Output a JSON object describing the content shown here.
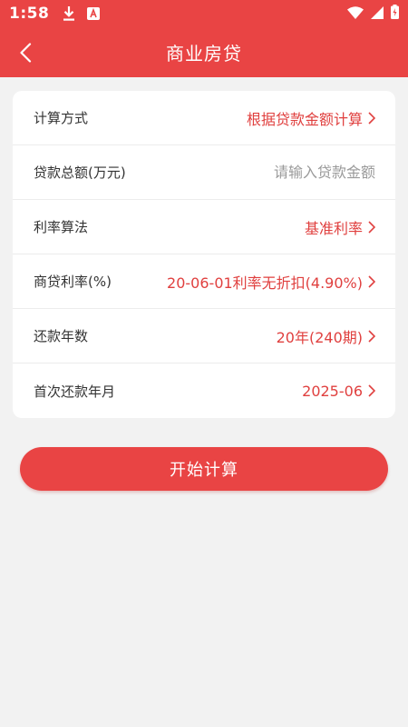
{
  "status_bar": {
    "time": "1:58",
    "icons": [
      "download-icon",
      "app-notification-icon",
      "wifi-icon",
      "signal-icon",
      "battery-icon"
    ]
  },
  "header": {
    "title": "商业房贷",
    "back_icon": "back-arrow-icon"
  },
  "form": {
    "rows": [
      {
        "label": "计算方式",
        "value": "根据贷款金额计算"
      },
      {
        "label": "贷款总额(万元)",
        "placeholder": "请输入贷款金额",
        "value": ""
      },
      {
        "label": "利率算法",
        "value": "基准利率"
      },
      {
        "label": "商贷利率(%)",
        "value": "20-06-01利率无折扣(4.90%)"
      },
      {
        "label": "还款年数",
        "value": "20年(240期)"
      },
      {
        "label": "首次还款年月",
        "value": "2025-06"
      }
    ]
  },
  "actions": {
    "calculate_label": "开始计算"
  },
  "colors": {
    "primary": "#e94444",
    "value_text": "#e0403f",
    "background": "#f2f2f2"
  }
}
